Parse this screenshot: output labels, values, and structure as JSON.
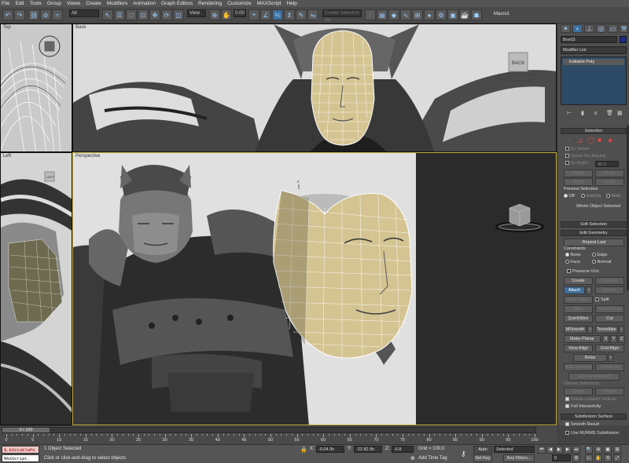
{
  "menu": [
    "File",
    "Edit",
    "Tools",
    "Group",
    "Views",
    "Create",
    "Modifiers",
    "Animation",
    "Graph Editors",
    "Rendering",
    "Customize",
    "MAXScript",
    "Help"
  ],
  "toolbar": {
    "filter_value": "All",
    "refcoord_value": "View",
    "spinner_value": "0.00",
    "named_selection_placeholder": "Create Selection Se",
    "macro_label": "Macro1"
  },
  "viewports": {
    "top_label": "Top",
    "back_label": "Back",
    "left_label": "Left",
    "perspective_label": "Perspective",
    "viewcube_back": "BACK",
    "viewcube_left": "LEFT"
  },
  "command_panel": {
    "object_name": "Box03",
    "modifier_list": "Modifier List",
    "stack_item": "Editable Poly",
    "selection_title": "Selection",
    "by_vertex": "By Vertex",
    "ignore_backfacing": "Ignore Backfacing",
    "by_angle": "By Angle:",
    "angle_value": "45.0",
    "shrink": "Shrink",
    "grow": "Grow",
    "ring": "Ring",
    "loop": "Loop",
    "preview_selection": "Preview Selection",
    "preview_off": "Off",
    "preview_subobj": "SubObj",
    "preview_multi": "Multi",
    "whole_object_selected": "Whole Object Selected",
    "soft_selection": "Soft Selection",
    "edit_geometry": "Edit Geometry",
    "repeat_last": "Repeat Last",
    "constraints": "Constraints",
    "none": "None",
    "edge": "Edge",
    "face": "Face",
    "normal": "Normal",
    "preserve_uvs": "Preserve UVs",
    "create": "Create",
    "collapse": "Collapse",
    "attach": "Attach",
    "detach": "Detach",
    "slice_plane": "Slice Plane",
    "split": "Split",
    "slice": "Slice",
    "reset_plane": "Reset Plane",
    "quickslice": "QuickSlice",
    "cut": "Cut",
    "msmooth": "MSmooth",
    "tessellate": "Tessellate",
    "make_planar": "Make Planar",
    "x": "X",
    "y": "Y",
    "z": "Z",
    "view_align": "View Align",
    "grid_align": "Grid Align",
    "relax": "Relax",
    "hide_selected": "Hide Selected",
    "unhide_all": "Unhide All",
    "hide_unselected": "Hide Unselected",
    "named_selections": "Named Selections:",
    "copy": "Copy",
    "paste": "Paste",
    "delete_isolated": "Delete Isolated Vertices",
    "full_interactivity": "Full Interactivity",
    "subdivision_surface": "Subdivision Surface",
    "smooth_result": "Smooth Result",
    "use_nurms": "Use NURMS Subdivision"
  },
  "timeline": {
    "frame_counter": "0 / 100",
    "ticks": [
      "0",
      "5",
      "10",
      "15",
      "20",
      "25",
      "30",
      "35",
      "40",
      "45",
      "50",
      "55",
      "60",
      "65",
      "70",
      "75",
      "80",
      "85",
      "90",
      "95",
      "100"
    ]
  },
  "status": {
    "script_line1": "$.EditablePo",
    "script_line2": "MAXScript.",
    "objects_selected": "1 Object Selected",
    "prompt": "Click or click-and-drag to select objects",
    "x_label": "X:",
    "x_value": "-0.04.9h",
    "y_label": "Y:",
    "y_value": "-22.82.9h",
    "z_label": "Z:",
    "z_value": "-6.8",
    "grid": "Grid = 100.0",
    "add_time_tag": "Add Time Tag",
    "auto_key": "Auto Key",
    "selected_value": "Selected",
    "set_key": "Set Key",
    "key_filters": "Key Filters...",
    "frame_value": "0"
  },
  "colors": {
    "accent": "#3e6e9c",
    "panel": "#4f4f4f",
    "face": "#d4c492",
    "wire": "#ffffff"
  }
}
